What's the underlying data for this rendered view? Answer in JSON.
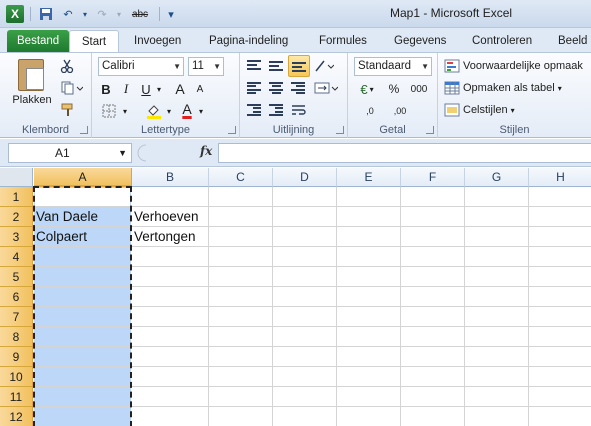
{
  "window": {
    "title": "Map1  -  Microsoft Excel"
  },
  "qat": {
    "logo_letter": "X",
    "undo": "↶",
    "redo": "↷",
    "spell": "abc",
    "customize": "▾"
  },
  "tabs": [
    {
      "label": "Bestand"
    },
    {
      "label": "Start"
    },
    {
      "label": "Invoegen"
    },
    {
      "label": "Pagina-indeling"
    },
    {
      "label": "Formules"
    },
    {
      "label": "Gegevens"
    },
    {
      "label": "Controleren"
    },
    {
      "label": "Beeld"
    }
  ],
  "ribbon": {
    "clipboard": {
      "label": "Klembord",
      "paste": "Plakken"
    },
    "font": {
      "label": "Lettertype",
      "font_name": "Calibri",
      "font_size": "11",
      "bold": "B",
      "italic": "I",
      "underline": "U",
      "grow": "A",
      "shrink": "A",
      "color_letter": "A"
    },
    "alignment": {
      "label": "Uitlijning"
    },
    "number": {
      "label": "Getal",
      "format": "Standaard",
      "currency": "€",
      "percent": "%",
      "thousands": "000",
      "inc_decimal": ",0",
      "dec_decimal": ",00"
    },
    "styles": {
      "label": "Stijlen",
      "conditional": "Voorwaardelijke opmaak",
      "as_table": "Opmaken als tabel",
      "cell_styles": "Celstijlen"
    }
  },
  "formula_bar": {
    "name_box": "A1",
    "fx": "fx",
    "formula": ""
  },
  "columns": [
    "A",
    "B",
    "C",
    "D",
    "E",
    "F",
    "G",
    "H"
  ],
  "rows": [
    "1",
    "2",
    "3",
    "4",
    "5",
    "6",
    "7",
    "8",
    "9",
    "10",
    "11",
    "12"
  ],
  "cells": {
    "A2": "Van Daele",
    "B2": "Verhoeven",
    "A3": "Colpaert",
    "B3": "Vertongen"
  },
  "colors": {
    "file_tab": "#1e7a2f",
    "selection": "#bcd7f7",
    "header_highlight": "#f1c15f"
  }
}
